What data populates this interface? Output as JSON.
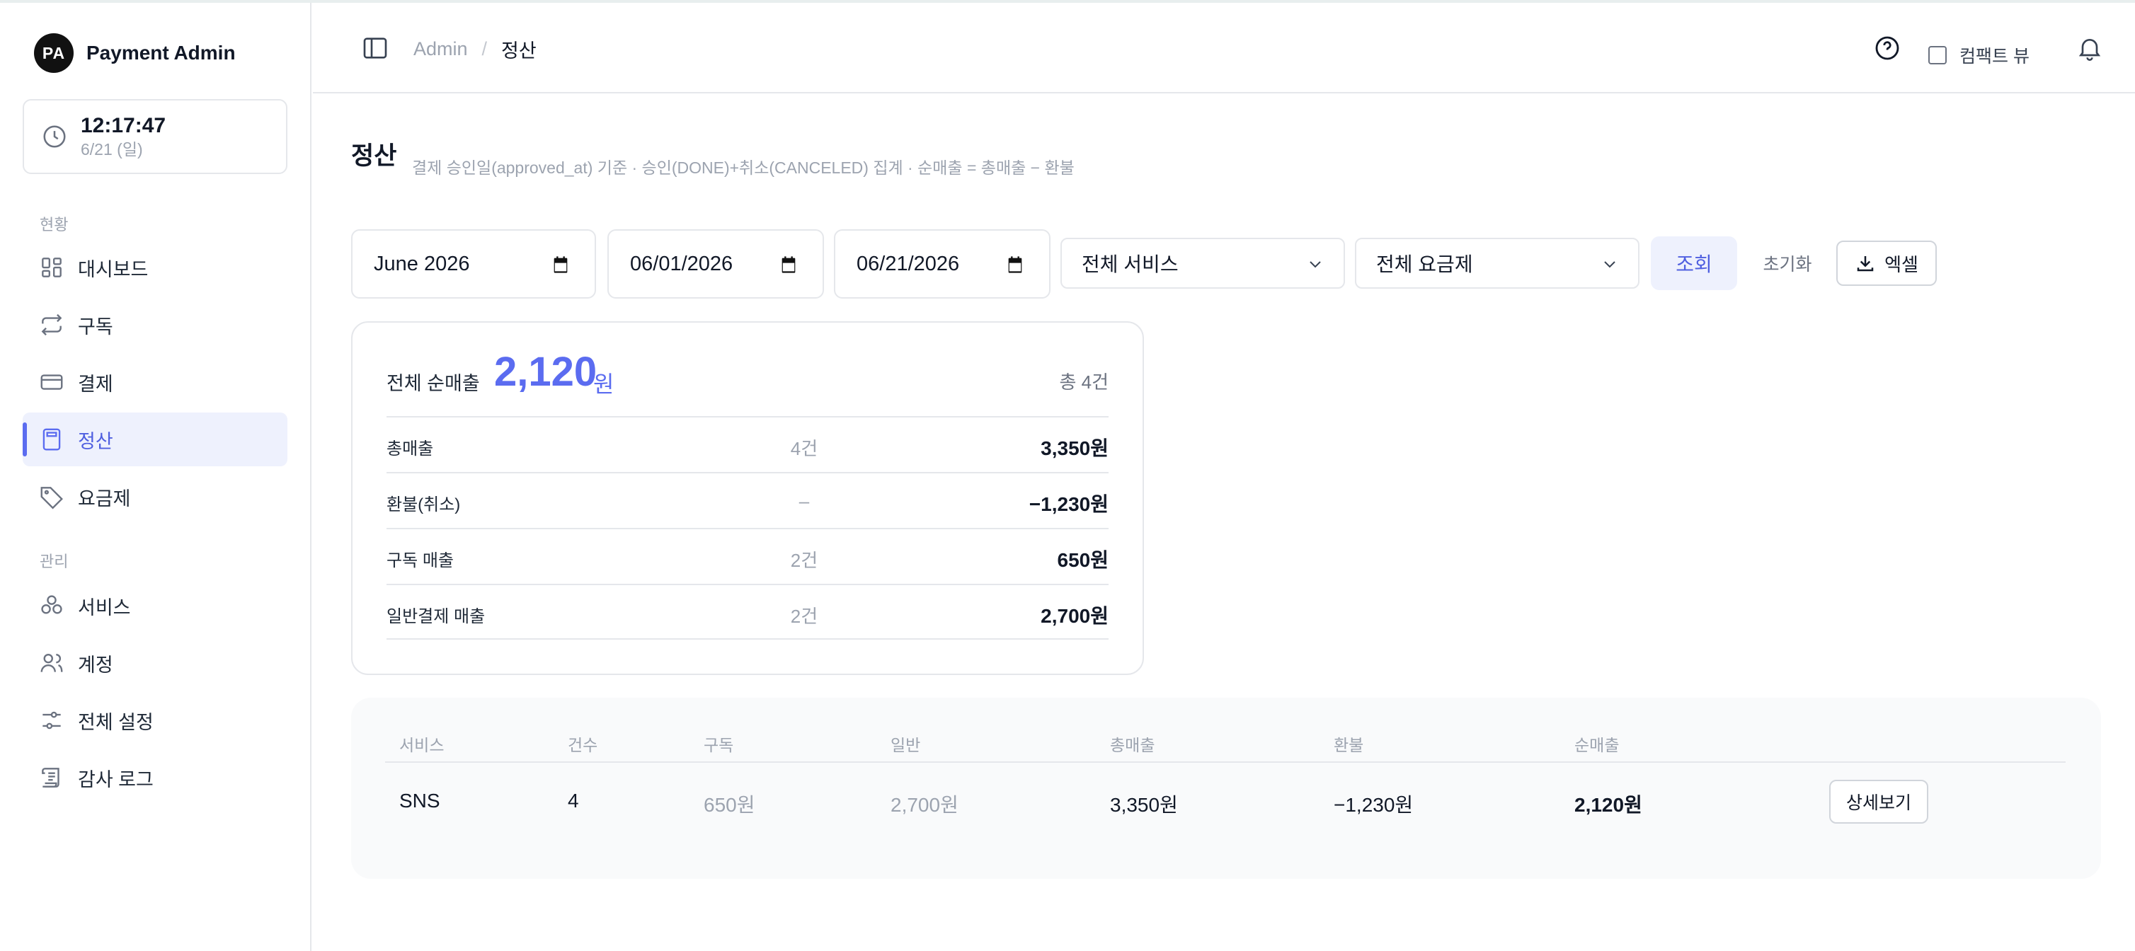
{
  "app": {
    "logo_text": "PA",
    "name": "Payment Admin"
  },
  "clock": {
    "time": "12:17:47",
    "date": "6/21 (일)"
  },
  "sidebar": {
    "sections": [
      {
        "title": "현황"
      },
      {
        "title": "관리"
      }
    ],
    "items": [
      {
        "label": "대시보드",
        "icon": "grid-icon"
      },
      {
        "label": "구독",
        "icon": "repeat-icon"
      },
      {
        "label": "결제",
        "icon": "credit-card-icon"
      },
      {
        "label": "정산",
        "icon": "calculator-icon",
        "active": true
      },
      {
        "label": "요금제",
        "icon": "tag-icon"
      },
      {
        "label": "서비스",
        "icon": "boxes-icon"
      },
      {
        "label": "계정",
        "icon": "users-icon"
      },
      {
        "label": "전체 설정",
        "icon": "sliders-icon"
      },
      {
        "label": "감사 로그",
        "icon": "scroll-icon"
      }
    ]
  },
  "header": {
    "breadcrumb_root": "Admin",
    "breadcrumb_sep": "/",
    "breadcrumb_current": "정산",
    "compact_view_label": "컴팩트 뷰"
  },
  "page": {
    "title": "정산",
    "subtitle": "결제 승인일(approved_at) 기준 · 승인(DONE)+취소(CANCELED) 집계 · 순매출 = 총매출 − 환불"
  },
  "filters": {
    "month": "June 2026",
    "start_date": "06/01/2026",
    "end_date": "06/21/2026",
    "service_select": "전체 서비스",
    "plan_select": "전체 요금제",
    "query_button": "조회",
    "reset_button": "초기화",
    "excel_button": "엑셀"
  },
  "summary": {
    "label": "전체 순매출",
    "amount": "2,120",
    "unit": "원",
    "total_count": "총 4건",
    "rows": [
      {
        "label": "총매출",
        "count": "4건",
        "amount": "3,350원"
      },
      {
        "label": "환불(취소)",
        "count": "–",
        "amount": "−1,230원"
      },
      {
        "label": "구독 매출",
        "count": "2건",
        "amount": "650원"
      },
      {
        "label": "일반결제 매출",
        "count": "2건",
        "amount": "2,700원"
      }
    ]
  },
  "table": {
    "headers": [
      "서비스",
      "건수",
      "구독",
      "일반",
      "총매출",
      "환불",
      "순매출"
    ],
    "rows": [
      {
        "service": "SNS",
        "count": "4",
        "subscription": "650원",
        "general": "2,700원",
        "gross": "3,350원",
        "refund": "−1,230원",
        "net": "2,120원",
        "action": "상세보기"
      }
    ]
  },
  "colors": {
    "accent": "#5b6cf0",
    "accent_bg": "#eef1fd"
  }
}
